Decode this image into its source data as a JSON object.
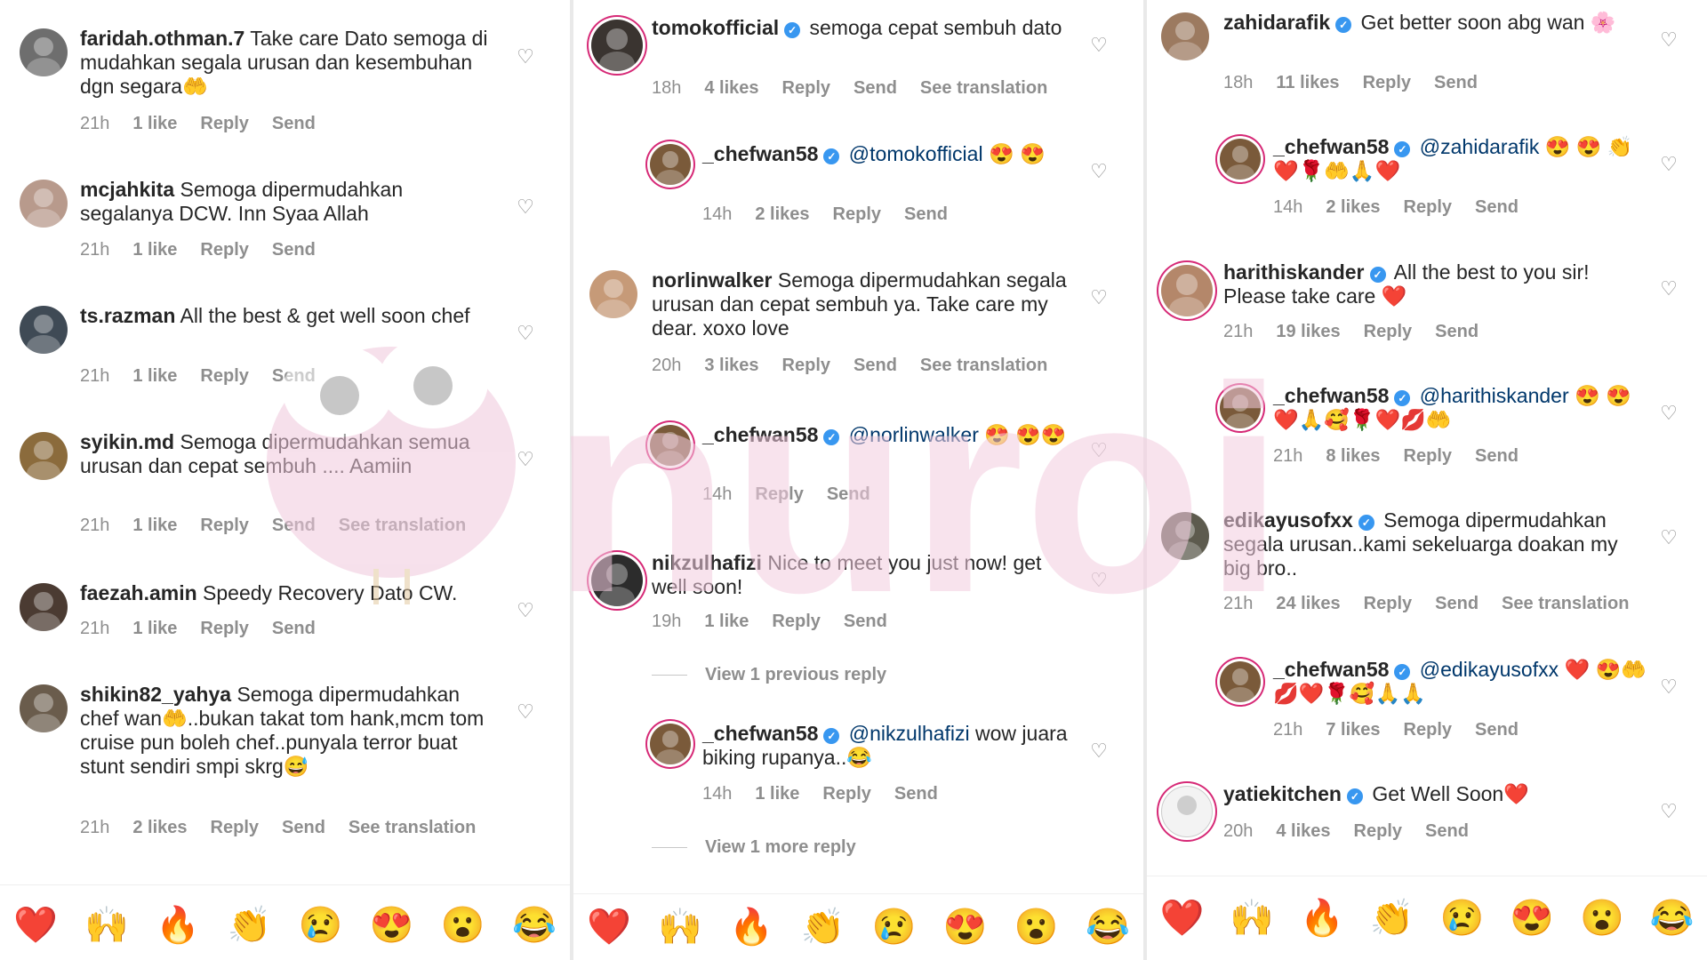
{
  "panel1": {
    "comments": [
      {
        "user": "faridah.othman.7",
        "text": "Take care Dato semoga di mudahkan segala urusan dan kesembuhan dgn segara🤲",
        "time": "21h",
        "likes": "1 like",
        "reply": "Reply",
        "send": "Send"
      },
      {
        "user": "mcjahkita",
        "text": "Semoga dipermudahkan segalanya DCW. Inn Syaa Allah",
        "time": "21h",
        "likes": "1 like",
        "reply": "Reply",
        "send": "Send"
      },
      {
        "user": "ts.razman",
        "text": "All the best & get well soon chef",
        "time": "21h",
        "likes": "1 like",
        "reply": "Reply",
        "send": "Send"
      },
      {
        "user": "syikin.md",
        "text": "Semoga dipermudahkan semua urusan dan cepat sembuh .... Aamiin",
        "time": "21h",
        "likes": "1 like",
        "reply": "Reply",
        "send": "Send",
        "translate": "See translation"
      },
      {
        "user": "faezah.amin",
        "text": "Speedy Recovery Dato CW.",
        "time": "21h",
        "likes": "1 like",
        "reply": "Reply",
        "send": "Send"
      },
      {
        "user": "shikin82_yahya",
        "text": "Semoga dipermudahkan chef wan🤲..bukan takat tom hank,mcm tom cruise pun boleh chef..punyala terror buat stunt sendiri smpi skrg😅",
        "time": "21h",
        "likes": "2 likes",
        "reply": "Reply",
        "send": "Send",
        "translate": "See translation"
      }
    ],
    "emojis": [
      "❤️",
      "🙌",
      "🔥",
      "👏",
      "😢",
      "😍",
      "😮",
      "😂"
    ]
  },
  "panel2": {
    "comments": [
      {
        "user": "tomokofficial",
        "text": "semoga cepat sembuh dato",
        "time": "18h",
        "likes": "4 likes",
        "reply": "Reply",
        "send": "Send",
        "translate": "See translation"
      },
      {
        "user": "_chefwan58",
        "mention": "@tomokofficial",
        "text": "😍 😍",
        "time": "14h",
        "likes": "2 likes",
        "reply": "Reply",
        "send": "Send"
      },
      {
        "user": "norlinwalker",
        "text": "Semoga dipermudahkan segala urusan dan cepat sembuh ya. Take care my dear. xoxo love",
        "time": "20h",
        "likes": "3 likes",
        "reply": "Reply",
        "send": "Send",
        "translate": "See translation"
      },
      {
        "user": "_chefwan58",
        "mention": "@norlinwalker",
        "text": "😍 😍😍",
        "time": "14h",
        "reply": "Reply",
        "send": "Send"
      },
      {
        "user": "nikzulhafizi",
        "text": "Nice to meet you just now! get well soon!",
        "time": "19h",
        "likes": "1 like",
        "reply": "Reply",
        "send": "Send"
      },
      {
        "user": "_chefwan58",
        "mention": "@nikzulhafizi",
        "text": "wow juara biking rupanya..😂",
        "time": "14h",
        "likes": "1 like",
        "reply": "Reply",
        "send": "Send"
      }
    ],
    "view_previous": "View 1 previous reply",
    "view_more": "View 1 more reply",
    "emojis": [
      "❤️",
      "🙌",
      "🔥",
      "👏",
      "😢",
      "😍",
      "😮",
      "😂"
    ]
  },
  "panel3": {
    "comments": [
      {
        "user": "zahidarafik",
        "text": "Get better soon abg wan 🌸",
        "time": "18h",
        "likes": "11 likes",
        "reply": "Reply",
        "send": "Send"
      },
      {
        "user": "_chefwan58",
        "mention": "@zahidarafik",
        "text": "😍 😍 👏❤️🌹🤲🙏❤️",
        "time": "14h",
        "likes": "2 likes",
        "reply": "Reply",
        "send": "Send"
      },
      {
        "user": "harithiskander",
        "text": "All the best to you sir! Please take care ❤️",
        "time": "21h",
        "likes": "19 likes",
        "reply": "Reply",
        "send": "Send"
      },
      {
        "user": "_chefwan58",
        "mention": "@harithiskander",
        "text": "😍 😍❤️🙏🥰🌹❤️💋🤲",
        "time": "21h",
        "likes": "8 likes",
        "reply": "Reply",
        "send": "Send"
      },
      {
        "user": "edikayusofxx",
        "text": "Semoga dipermudahkan segala urusan..kami sekeluarga doakan my big bro..",
        "time": "21h",
        "likes": "24 likes",
        "reply": "Reply",
        "send": "Send",
        "translate": "See translation"
      },
      {
        "user": "_chefwan58",
        "mention": "@edikayusofxx",
        "text": "❤️ 😍🤲💋❤️🌹🥰🙏🙏",
        "time": "21h",
        "likes": "7 likes",
        "reply": "Reply",
        "send": "Send"
      },
      {
        "user": "yatiekitchen",
        "text": "Get Well Soon❤️",
        "time": "20h",
        "likes": "4 likes",
        "reply": "Reply",
        "send": "Send"
      }
    ],
    "emojis": [
      "❤️",
      "🙌",
      "🔥",
      "👏",
      "😢",
      "😍",
      "😮",
      "😂"
    ]
  },
  "heart_icon": "♡",
  "verified_glyph": "✓",
  "watermark_text": "nuroi",
  "colors": {
    "mention": "#00376b",
    "verified": "#3897f0",
    "meta": "#8e8e8e",
    "ring": "#d62976",
    "watermark": "#f4cde0"
  }
}
